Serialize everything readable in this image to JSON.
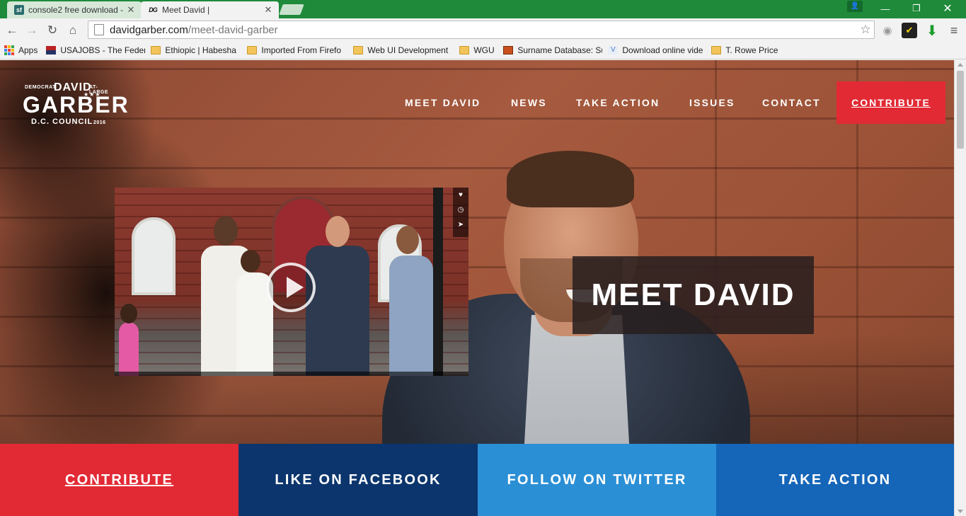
{
  "browser": {
    "tabs": [
      {
        "title": "console2 free download -",
        "favicon": "sf-icon"
      },
      {
        "title": "Meet David |",
        "favicon": "dg-icon"
      }
    ],
    "url_domain": "davidgarber.com",
    "url_path": "/meet-david-garber",
    "bookmarks": [
      {
        "label": "Apps",
        "icon": "apps-icon"
      },
      {
        "label": "USAJOBS - The Feder",
        "icon": "usajobs-icon"
      },
      {
        "label": "Ethiopic | Habesha",
        "icon": "folder-icon"
      },
      {
        "label": "Imported From Firefo",
        "icon": "folder-icon"
      },
      {
        "label": "Web UI Development",
        "icon": "folder-icon"
      },
      {
        "label": "WGU",
        "icon": "folder-icon"
      },
      {
        "label": "Surname Database: Su",
        "icon": "surname-icon"
      },
      {
        "label": "Download online vide",
        "icon": "video-icon"
      },
      {
        "label": "T. Rowe Price",
        "icon": "folder-icon"
      }
    ]
  },
  "site": {
    "logo": {
      "democrat": "DEMOCRAT",
      "david": "DAVID",
      "at_large": "AT-LARGE",
      "garber": "GARBER",
      "council": "D.C. COUNCIL",
      "year": "2016"
    },
    "nav": {
      "meet_david": "MEET DAVID",
      "news": "NEWS",
      "take_action": "TAKE ACTION",
      "issues": "ISSUES",
      "contact": "CONTACT",
      "contribute": "CONTRIBUTE"
    },
    "hero_title": "MEET DAVID",
    "cta": {
      "contribute": "CONTRIBUTE",
      "facebook": "LIKE ON FACEBOOK",
      "twitter": "FOLLOW ON TWITTER",
      "take_action": "TAKE ACTION"
    }
  },
  "colors": {
    "red": "#e22a35",
    "navy": "#0c356d",
    "sky": "#2b8fd5",
    "blue": "#1565b8",
    "chrome_green": "#1e8a3a"
  }
}
